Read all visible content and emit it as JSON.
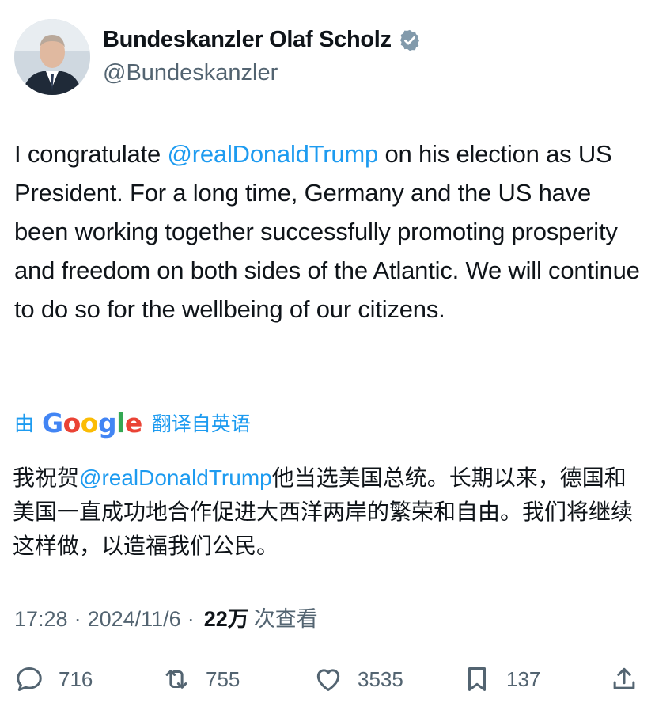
{
  "author": {
    "display_name": "Bundeskanzler Olaf Scholz",
    "handle": "@Bundeskanzler",
    "avatar_icon": "profile-photo",
    "verified_icon": "verified-badge-icon"
  },
  "tweet": {
    "text_part1": "I congratulate ",
    "mention": "@realDonaldTrump",
    "text_part2": " on his election as US President. For a long time, Germany and the US have been working together successfully promoting prosperity and freedom on both sides of the Atlantic. We will continue to do so for the wellbeing of our citizens."
  },
  "translation": {
    "prefix": "由",
    "provider": "Google",
    "suffix": "翻译自英语",
    "text_part1": "我祝贺",
    "mention": "@realDonaldTrump",
    "text_part2": "他当选美国总统。长期以来，德国和美国一直成功地合作促进大西洋两岸的繁荣和自由。我们将继续这样做，以造福我们公民。"
  },
  "meta": {
    "time": "17:28",
    "separator": "·",
    "date": "2024/11/6",
    "views_count": "22万",
    "views_label": "次查看"
  },
  "actions": {
    "replies": "716",
    "reposts": "755",
    "likes": "3535",
    "bookmarks": "137"
  },
  "colors": {
    "link": "#1d9bf0",
    "secondary_text": "#536471",
    "primary_text": "#0f1419",
    "verified_badge": "#829aab"
  }
}
